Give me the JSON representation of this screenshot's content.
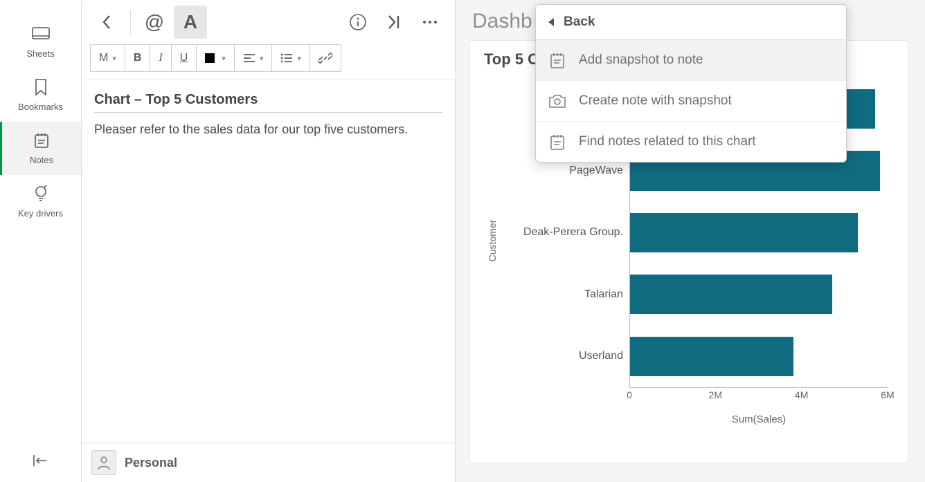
{
  "sidebar": {
    "items": [
      {
        "label": "Sheets"
      },
      {
        "label": "Bookmarks"
      },
      {
        "label": "Notes"
      },
      {
        "label": "Key drivers"
      }
    ]
  },
  "toolbar": {
    "at_label": "@",
    "a_label": "A",
    "size_label": "M",
    "bold": "B",
    "italic": "I",
    "underline": "U"
  },
  "note": {
    "title": "Chart – Top 5 Customers",
    "body": "Pleaser refer to the sales data for our top five customers."
  },
  "notes_panel": {
    "owner": "Personal"
  },
  "dashboard": {
    "title": "Dashb"
  },
  "context_menu": {
    "back": "Back",
    "items": [
      {
        "label": "Add snapshot to note"
      },
      {
        "label": "Create note with snapshot"
      },
      {
        "label": "Find notes related to this chart"
      }
    ]
  },
  "chart_data": {
    "type": "bar",
    "title": "Top 5 C",
    "ylabel": "Customer",
    "xlabel": "Sum(Sales)",
    "xlim": [
      0,
      6000000
    ],
    "xticks": [
      "0",
      "2M",
      "4M",
      "6M"
    ],
    "categories": [
      "",
      "PageWave",
      "Deak-Perera Group.",
      "Talarian",
      "Userland"
    ],
    "values": [
      5700000,
      5800000,
      5300000,
      4700000,
      3800000
    ],
    "bar_color": "#116b80"
  }
}
